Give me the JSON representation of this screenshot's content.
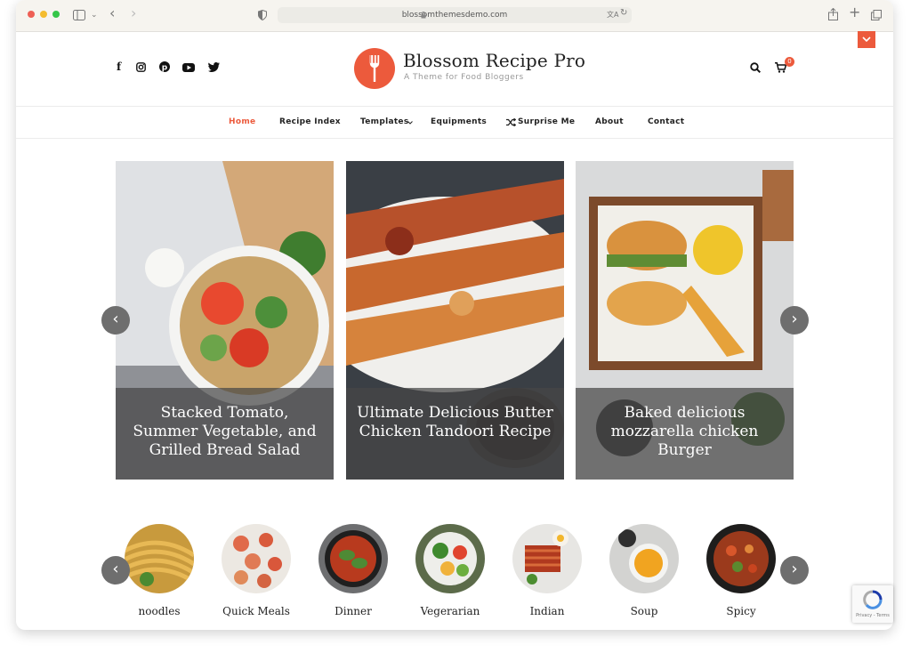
{
  "browser": {
    "url": "blossomthemesdemo.com"
  },
  "header": {
    "site_title": "Blossom Recipe Pro",
    "tagline": "A Theme for Food Bloggers",
    "social": [
      "facebook-icon",
      "instagram-icon",
      "pinterest-icon",
      "youtube-icon",
      "twitter-icon"
    ],
    "cart_count": "0",
    "accent": "#ec5a3c"
  },
  "nav": {
    "items": [
      {
        "label": "Home"
      },
      {
        "label": "Recipe Index"
      },
      {
        "label": "Templates"
      },
      {
        "label": "Equipments"
      },
      {
        "label": "Surprise Me"
      },
      {
        "label": "About"
      },
      {
        "label": "Contact"
      }
    ]
  },
  "slider": {
    "slides": [
      {
        "title": "Stacked Tomato, Summer Vegetable, and Grilled Bread Salad"
      },
      {
        "title": "Ultimate Delicious Butter Chicken Tandoori Recipe"
      },
      {
        "title": "Baked delicious mozzarella chicken Burger"
      }
    ]
  },
  "categories": {
    "items": [
      {
        "label": "noodles"
      },
      {
        "label": "Quick Meals"
      },
      {
        "label": "Dinner"
      },
      {
        "label": "Vegerarian"
      },
      {
        "label": "Indian"
      },
      {
        "label": "Soup"
      },
      {
        "label": "Spicy"
      }
    ]
  },
  "recaptcha": {
    "label": "Privacy - Terms"
  }
}
